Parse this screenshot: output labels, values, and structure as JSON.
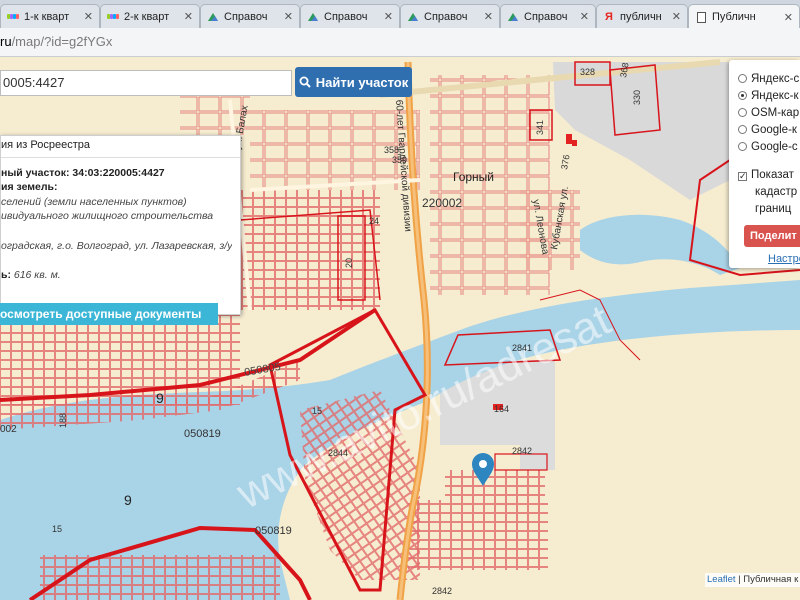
{
  "browser": {
    "tabs": [
      {
        "label": "1-к кварт",
        "icon": "avito-icon"
      },
      {
        "label": "2-к кварт",
        "icon": "avito-icon"
      },
      {
        "label": "Справоч",
        "icon": "spravochnik-icon"
      },
      {
        "label": "Справоч",
        "icon": "spravochnik-icon"
      },
      {
        "label": "Справоч",
        "icon": "spravochnik-icon"
      },
      {
        "label": "Справоч",
        "icon": "spravochnik-icon"
      },
      {
        "label": "публичн",
        "icon": "yandex-icon"
      },
      {
        "label": "Публичн",
        "icon": "document-icon"
      }
    ],
    "address": {
      "domain": "ru",
      "path": "/map/?id=g2fYGx"
    }
  },
  "search": {
    "value": "0005:4427",
    "button_label": "Найти участок"
  },
  "info_popup": {
    "title": "ия из Росреестра",
    "lines": [
      {
        "label": "ный участок:",
        "value": "34:03:220005:4427"
      },
      {
        "label": "ия земель:",
        "value": ""
      }
    ],
    "category_1": "селений (земли населенных пунктов)",
    "category_2": "ивидуального жилищного строительства",
    "address_text": "оградская, г.о. Волгоград, ул. Лазаревская, з/у",
    "area_label": "ь:",
    "area_value": "616 кв. м.",
    "docs_button": "осмотреть доступные документы"
  },
  "layers_panel": {
    "options": [
      {
        "label": "Яндекс-с",
        "selected": false
      },
      {
        "label": "Яндекс-к",
        "selected": true
      },
      {
        "label": "OSM-кар",
        "selected": false
      },
      {
        "label": "Google-к",
        "selected": false
      },
      {
        "label": "Google-с",
        "selected": false
      }
    ],
    "show_checkbox": {
      "lines": [
        "Показат",
        "кадастр",
        "границ"
      ],
      "checked": true
    },
    "share_button": "Поделит",
    "settings_link": "Настро"
  },
  "map_labels": {
    "gorny": "Горный",
    "block_220002": "220002",
    "block_050805": "050805",
    "block_050819_a": "050819",
    "block_050819_b": "050819",
    "street_60let": "60-лет Гвардейской дивизии",
    "street_balakh": "ул. Балах",
    "street_kuban": "Кубанская ул.",
    "street_leonova": "ул. Леонова",
    "num_328": "328",
    "num_368": "368",
    "num_330": "330",
    "num_341": "341",
    "num_376": "376",
    "num_358": "358",
    "num_359": "359",
    "num_24": "24",
    "num_20": "20",
    "num_2841": "2841",
    "num_164": "164",
    "num_2842a": "2842",
    "num_2844": "2844",
    "num_2842b": "2842",
    "num_9a": "9",
    "num_9b": "9",
    "num_15a": "15",
    "num_15b": "15",
    "num_188": "188",
    "num_002": "002",
    "watermark": "www.avito.ru/adresat"
  },
  "attribution": {
    "leaflet": "Leaflet",
    "rest": " | Публичная к"
  },
  "colors": {
    "land": "#f6ecd0",
    "water": "#a9d3e6",
    "parcel": "#e36a6a",
    "border": "#d8141b",
    "road": "#f0a247",
    "built": "#d9d9d9",
    "button_blue": "#2f6fb0",
    "docs_cyan": "#3cb6d6",
    "share_red": "#d9534f"
  }
}
